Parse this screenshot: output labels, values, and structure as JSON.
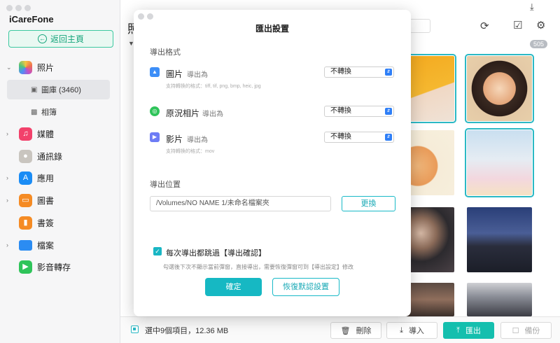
{
  "app": {
    "title": "iCareFone",
    "back_label": "返回主頁",
    "partial_header": "照"
  },
  "sidebar": {
    "items": [
      {
        "label": "照片",
        "icon": "photos-icon"
      },
      {
        "label": "圖庫 (3460)",
        "icon": "gallery-icon"
      },
      {
        "label": "相簿",
        "icon": "album-icon"
      },
      {
        "label": "媒體",
        "icon": "music-icon"
      },
      {
        "label": "通訊錄",
        "icon": "contacts-icon"
      },
      {
        "label": "應用",
        "icon": "appstore-icon"
      },
      {
        "label": "圖書",
        "icon": "books-icon"
      },
      {
        "label": "書簽",
        "icon": "bookmark-icon"
      },
      {
        "label": "檔案",
        "icon": "folder-icon"
      },
      {
        "label": "影音轉存",
        "icon": "video-transfer-icon"
      }
    ]
  },
  "main": {
    "count_badge": "505"
  },
  "modal": {
    "title": "匯出設置",
    "format_section": "導出格式",
    "formats": [
      {
        "name": "圖片",
        "sub": "導出為",
        "value": "不轉換",
        "note": "支持轉換的格式：tiff, tif, png, bmp, heic, jpg"
      },
      {
        "name": "原況相片",
        "sub": "導出為",
        "value": "不轉換",
        "note": ""
      },
      {
        "name": "影片",
        "sub": "導出為",
        "value": "不轉換",
        "note": "支持轉換的格式：mov"
      }
    ],
    "location_section": "導出位置",
    "path": "/Volumes/NO NAME 1/未命名檔案夾",
    "change_label": "更換",
    "skip_label": "每次導出都跳過【導出確認】",
    "skip_note": "勾選後下次不顯示當前彈窗，直接導出，需要恢復彈窗可到【導出設定】修改",
    "confirm_label": "確定",
    "reset_label": "恢復默認設置"
  },
  "bottom": {
    "selection_text": "選中9個項目，12.36 MB",
    "delete_label": "刪除",
    "import_label": "導入",
    "export_label": "匯出",
    "backup_label": "備份"
  }
}
